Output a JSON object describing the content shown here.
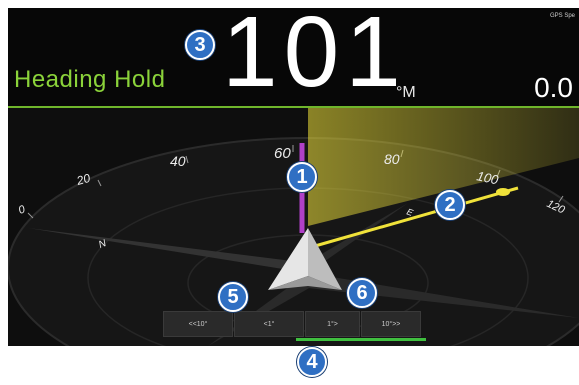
{
  "header": {
    "title": "Heading Hold",
    "heading_value": "101",
    "heading_unit": "°M",
    "gps_label": "GPS Spe",
    "speed_value": "0.0"
  },
  "compass": {
    "tick_labels": [
      "0",
      "20",
      "40",
      "60",
      "80",
      "100",
      "120"
    ],
    "inner_labels": [
      "N",
      "E"
    ]
  },
  "buttons": [
    {
      "label": "<<10°"
    },
    {
      "label": "<1°"
    },
    {
      "label": "1°>"
    },
    {
      "label": "10°>>"
    }
  ],
  "callouts": [
    "1",
    "2",
    "3",
    "4",
    "5",
    "6"
  ],
  "colors": {
    "title_green": "#8bd33a",
    "divider_green": "#6fb52b",
    "heading_line_yellow": "#f0e23a",
    "current_heading_magenta": "#b040c8",
    "callout_blue": "#2f6fc3"
  }
}
